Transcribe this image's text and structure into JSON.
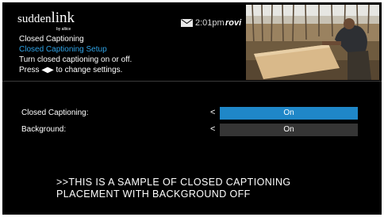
{
  "header": {
    "logo_main": "sudden",
    "logo_tail": "link",
    "logo_sub": "by altice",
    "time": "2:01pm",
    "guide_brand": "rovi"
  },
  "info": {
    "title": "Closed Captioning",
    "subtitle": "Closed Captioning Setup",
    "line1": "Turn closed captioning on or off.",
    "line2": "Press ◀▶ to change settings."
  },
  "settings": [
    {
      "label": "Closed Captioning:",
      "arrow": "<",
      "value": "On",
      "highlighted": true
    },
    {
      "label": "Background:",
      "arrow": "<",
      "value": "On",
      "highlighted": false
    }
  ],
  "caption": {
    "line1": ">>THIS IS A SAMPLE OF CLOSED CAPTIONING",
    "line2": "PLACEMENT WITH BACKGROUND OFF"
  },
  "colors": {
    "background": "#000000",
    "highlight": "#1f87c8",
    "inactive": "#353535",
    "selected_text": "#2fa2e4"
  },
  "icons": [
    "mail-icon",
    "left-arrow-icon"
  ]
}
